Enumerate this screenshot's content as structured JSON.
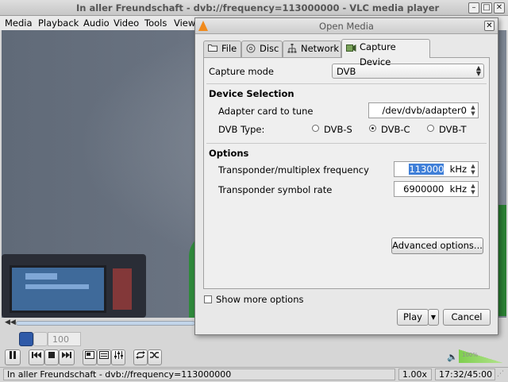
{
  "vlc": {
    "title": "In aller Freundschaft - dvb://frequency=113000000 - VLC media player",
    "menu": [
      "Media",
      "Playback",
      "Audio",
      "Video",
      "Tools",
      "View"
    ],
    "window_buttons": [
      "–",
      "□",
      "✕"
    ],
    "zoom_value": "100",
    "volume_label": "100%",
    "status": {
      "title": "In aller Freundschaft - dvb://frequency=113000000",
      "speed": "1.00x",
      "time": "17:32/45:00"
    }
  },
  "dialog": {
    "title": "Open Media",
    "close_glyph": "✕",
    "tabs": [
      {
        "label": "File",
        "icon": "folder-icon"
      },
      {
        "label": "Disc",
        "icon": "disc-icon"
      },
      {
        "label": "Network",
        "icon": "network-icon"
      },
      {
        "label": "Capture Device",
        "icon": "capture-device-icon"
      }
    ],
    "active_tab": "Capture Device",
    "capture_mode_label": "Capture mode",
    "capture_mode_value": "DVB",
    "device_selection_heading": "Device Selection",
    "adapter_label": "Adapter card to tune",
    "adapter_value": "/dev/dvb/adapter0",
    "dvb_type_label": "DVB Type:",
    "dvb_types": [
      {
        "label": "DVB-S",
        "selected": false
      },
      {
        "label": "DVB-C",
        "selected": true
      },
      {
        "label": "DVB-T",
        "selected": false
      }
    ],
    "options_heading": "Options",
    "frequency_label": "Transponder/multiplex frequency",
    "frequency_value": "113000",
    "frequency_unit": "kHz",
    "symbol_rate_label": "Transponder symbol rate",
    "symbol_rate_value": "6900000",
    "symbol_rate_unit": "kHz",
    "advanced_button": "Advanced options...",
    "show_more_label": "Show more options",
    "play_button": "Play",
    "cancel_button": "Cancel"
  },
  "colors": {
    "selection": "#3f7fd8",
    "vlc_orange": "#f08a1c",
    "volume_green": "#7fcf4e"
  }
}
